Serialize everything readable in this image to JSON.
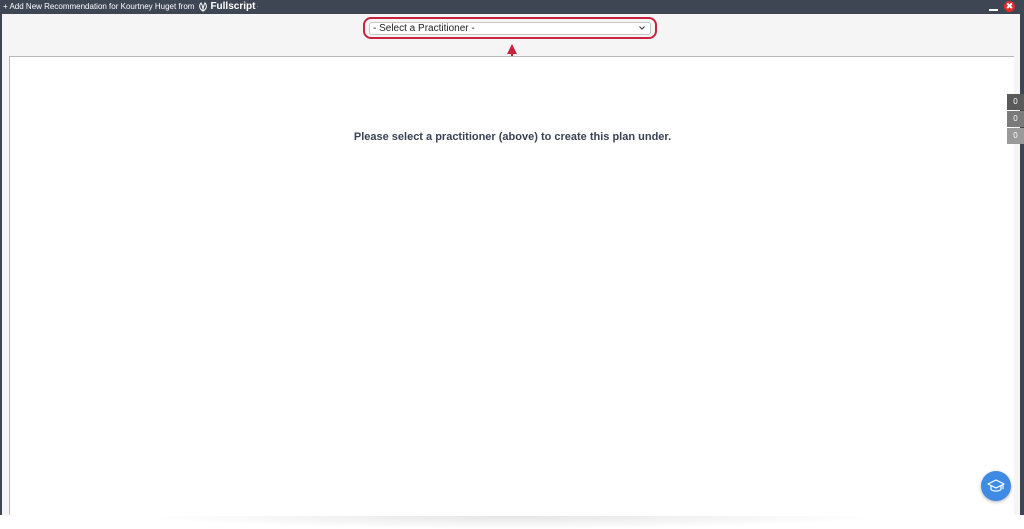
{
  "window": {
    "title": "+ Add New Recommendation for Kourtney Huget from",
    "brand": "Fullscript",
    "brand_tm": "·",
    "minimize_icon": "minimize-icon",
    "close_icon": "close-icon",
    "close_glyph": "✖"
  },
  "practitioner_select": {
    "selected": "- Select a Practitioner -",
    "chevron_icon": "chevron-down-icon",
    "highlight_color": "#c8243f"
  },
  "main": {
    "message": "Please select a practitioner (above) to create this plan under."
  },
  "side_counters": [
    {
      "value": "0"
    },
    {
      "value": "0"
    },
    {
      "value": "0"
    }
  ],
  "help": {
    "icon": "graduation-cap-icon",
    "color": "#3f8be3"
  },
  "colors": {
    "titlebar": "#3e4654",
    "close": "#e02c2c",
    "annotation": "#c8243f"
  }
}
